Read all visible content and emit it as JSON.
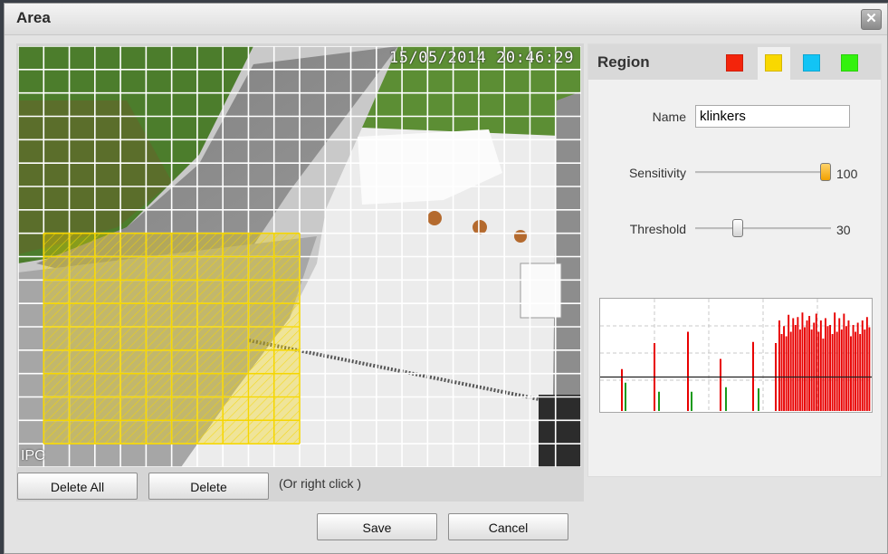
{
  "dialog": {
    "title": "Area",
    "close_label": "✕"
  },
  "video": {
    "timestamp": "15/05/2014 20:46:29",
    "camera_label": "IPC",
    "grid_cols": 22,
    "grid_rows": 18,
    "selected_cells": {
      "col_start": 1,
      "col_end": 10,
      "row_start": 8,
      "row_end": 16
    },
    "selection_color": "#f5d600",
    "grid_color": "#ffffff"
  },
  "buttons": {
    "delete_all": "Delete All",
    "delete": "Delete",
    "hint": "(Or right click )",
    "save": "Save",
    "cancel": "Cancel"
  },
  "region": {
    "title": "Region",
    "colors": [
      {
        "name": "red",
        "hex": "#f3240b",
        "active": false
      },
      {
        "name": "yellow",
        "hex": "#f9d800",
        "active": true
      },
      {
        "name": "blue",
        "hex": "#12c4f5",
        "active": false
      },
      {
        "name": "green",
        "hex": "#33f20e",
        "active": false
      }
    ],
    "name_label": "Name",
    "name_value": "klinkers",
    "sensitivity_label": "Sensitivity",
    "sensitivity": 100,
    "threshold_label": "Threshold",
    "threshold": 30
  },
  "graph": {
    "threshold_fraction": 0.3,
    "red_color": "#e80000",
    "green_color": "#1a9a1a",
    "red_spikes": [
      0.37,
      0.6,
      0.7,
      0.46,
      0.61,
      0.6
    ],
    "green_spikes": [
      0.25,
      0.17,
      0.17,
      0.21,
      0.2
    ],
    "red_block": [
      0.8,
      0.68,
      0.75,
      0.66,
      0.85,
      0.7,
      0.82,
      0.76,
      0.83,
      0.72,
      0.87,
      0.74,
      0.8,
      0.84,
      0.72,
      0.78,
      0.86,
      0.7,
      0.8,
      0.64,
      0.82,
      0.75,
      0.76,
      0.68,
      0.87,
      0.7,
      0.82,
      0.72,
      0.86,
      0.75,
      0.8,
      0.66,
      0.76,
      0.7,
      0.78,
      0.68,
      0.8,
      0.72,
      0.83,
      0.74
    ]
  }
}
